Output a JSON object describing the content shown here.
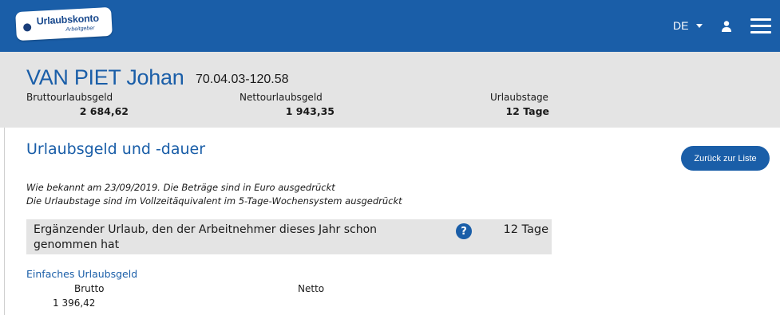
{
  "header": {
    "logo_title": "Urlaubskonto",
    "logo_subtitle": "Arbeitgeber",
    "language": "DE",
    "icons": {
      "user": "user-icon",
      "menu": "hamburger-menu-icon",
      "language_caret": "caret-down-icon"
    },
    "colors": {
      "brand": "#1a5ea8",
      "band": "#e4e4e4"
    }
  },
  "person": {
    "name": "VAN PIET Johan",
    "id": "70.04.03-120.58",
    "metrics": [
      {
        "label": "Bruttourlaubsgeld",
        "value": "2 684,62"
      },
      {
        "label": "Nettourlaubsgeld",
        "value": "1 943,35"
      },
      {
        "label": "Urlaubstage",
        "value": "12 Tage"
      }
    ]
  },
  "main": {
    "title": "Urlaubsgeld und -dauer",
    "back_button": "Zurück zur Liste",
    "notes": [
      "Wie bekannt am 23/09/2019. Die Beträge sind in Euro ausgedrückt",
      "Die Urlaubstage sind im Vollzeitäquivalent im 5-Tage-Wochensystem ausgedrückt"
    ],
    "info_row": {
      "text": "Ergänzender Urlaub, den der Arbeitnehmer dieses Jahr schon genommen hat",
      "help_symbol": "?",
      "help_icon": "help-icon",
      "value": "12 Tage"
    },
    "simple_holiday_pay": {
      "title": "Einfaches Urlaubsgeld",
      "columns": [
        {
          "label": "Brutto",
          "value": "1 396,42"
        },
        {
          "label": "Netto",
          "value": ""
        }
      ]
    }
  }
}
